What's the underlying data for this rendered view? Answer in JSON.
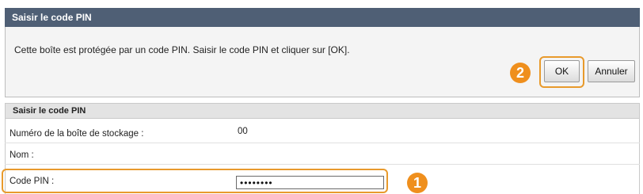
{
  "dialog": {
    "title": "Saisir le code PIN",
    "instruction": "Cette boîte est protégée par un code PIN. Saisir le code PIN et cliquer sur [OK].",
    "ok_label": "OK",
    "cancel_label": "Annuler"
  },
  "form": {
    "section_title": "Saisir le code PIN",
    "storage_label": "Numéro de la boîte de stockage :",
    "storage_value": "00",
    "name_label": "Nom :",
    "pin_label": "Code PIN :",
    "pin_value": "••••••••"
  },
  "callouts": {
    "step1": "1",
    "step2": "2"
  },
  "colors": {
    "header_bg": "#4f5f75",
    "highlight": "#e89a2c",
    "callout": "#ef8f1d"
  }
}
